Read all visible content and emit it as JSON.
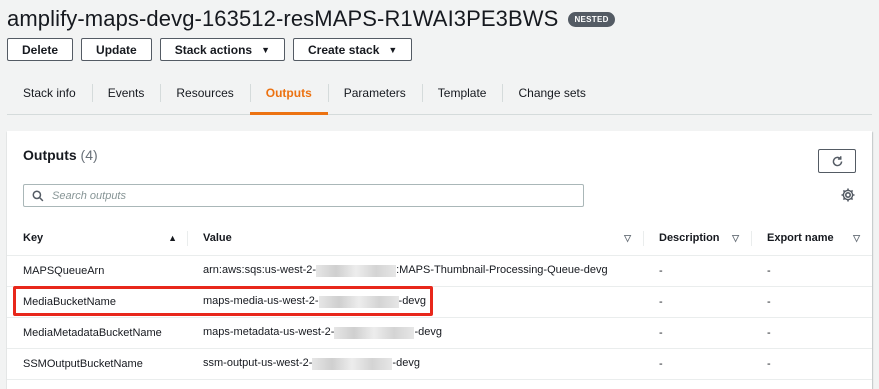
{
  "header": {
    "title": "amplify-maps-devg-163512-resMAPS-R1WAI3PE3BWS",
    "badge": "NESTED"
  },
  "actions": {
    "delete": "Delete",
    "update": "Update",
    "stack_actions": "Stack actions",
    "create_stack": "Create stack"
  },
  "tabs": [
    {
      "label": "Stack info"
    },
    {
      "label": "Events"
    },
    {
      "label": "Resources"
    },
    {
      "label": "Outputs",
      "active": true
    },
    {
      "label": "Parameters"
    },
    {
      "label": "Template"
    },
    {
      "label": "Change sets"
    }
  ],
  "outputs": {
    "title": "Outputs",
    "count": "(4)",
    "search_placeholder": "Search outputs",
    "columns": {
      "key": "Key",
      "value": "Value",
      "description": "Description",
      "export_name": "Export name"
    },
    "rows": [
      {
        "key": "MAPSQueueArn",
        "value_prefix": "arn:aws:sqs:us-west-2-",
        "value_suffix": ":MAPS-Thumbnail-Processing-Queue-devg",
        "description": "-",
        "export_name": "-"
      },
      {
        "key": "MediaBucketName",
        "value_prefix": "maps-media-us-west-2-",
        "value_suffix": "-devg",
        "description": "-",
        "export_name": "-"
      },
      {
        "key": "MediaMetadataBucketName",
        "value_prefix": "maps-metadata-us-west-2-",
        "value_suffix": "-devg",
        "description": "-",
        "export_name": "-"
      },
      {
        "key": "SSMOutputBucketName",
        "value_prefix": "ssm-output-us-west-2-",
        "value_suffix": "-devg",
        "description": "-",
        "export_name": "-"
      }
    ]
  },
  "colors": {
    "accent": "#ec7211",
    "highlight": "#e8271b"
  }
}
